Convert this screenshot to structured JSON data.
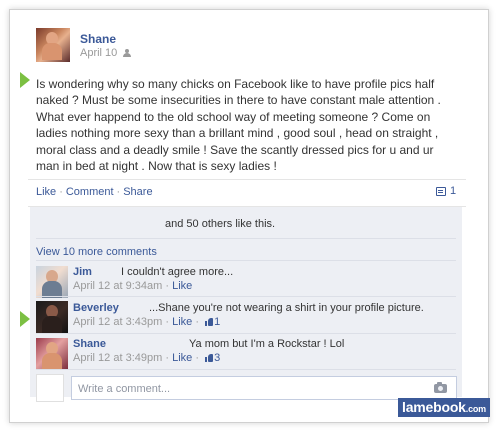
{
  "post": {
    "author": "Shane",
    "date": "April 10",
    "audience_icon": "friends-icon",
    "text": "Is wondering why so many chicks on Facebook like to have profile pics half naked ? Must be some insecurities in there to have constant male attention . What ever happend to the old school way of meeting someone ? Come on ladies nothing more sexy than a brillant mind , good soul , head on straight , moral class and a deadly smile ! Save the scantly dressed pics for u and ur man in bed at night . Now that is sexy ladies !"
  },
  "actions": {
    "like": "Like",
    "comment": "Comment",
    "share": "Share",
    "separator": "·",
    "comment_count": "1"
  },
  "likes": {
    "text": "and 50 others like this."
  },
  "view_more": "View 10 more comments",
  "comments": [
    {
      "name": "Jim",
      "text": "I couldn't agree more...",
      "time": "April 12 at 9:34am",
      "like": "Like",
      "likes": ""
    },
    {
      "name": "Beverley",
      "text": "...Shane you're not wearing a shirt in your profile picture.",
      "time": "April 12 at 3:43pm",
      "like": "Like",
      "likes": "1"
    },
    {
      "name": "Shane",
      "text": "Ya mom but I'm a Rockstar ! Lol",
      "time": "April 12 at 3:49pm",
      "like": "Like",
      "likes": "3"
    }
  ],
  "composer": {
    "placeholder": "Write a comment..."
  },
  "watermark": {
    "brand": "lamebook",
    "tld": ".com"
  },
  "colors": {
    "link": "#3b5998",
    "marker": "#7cc043",
    "ufi_background": "#edeff4"
  }
}
